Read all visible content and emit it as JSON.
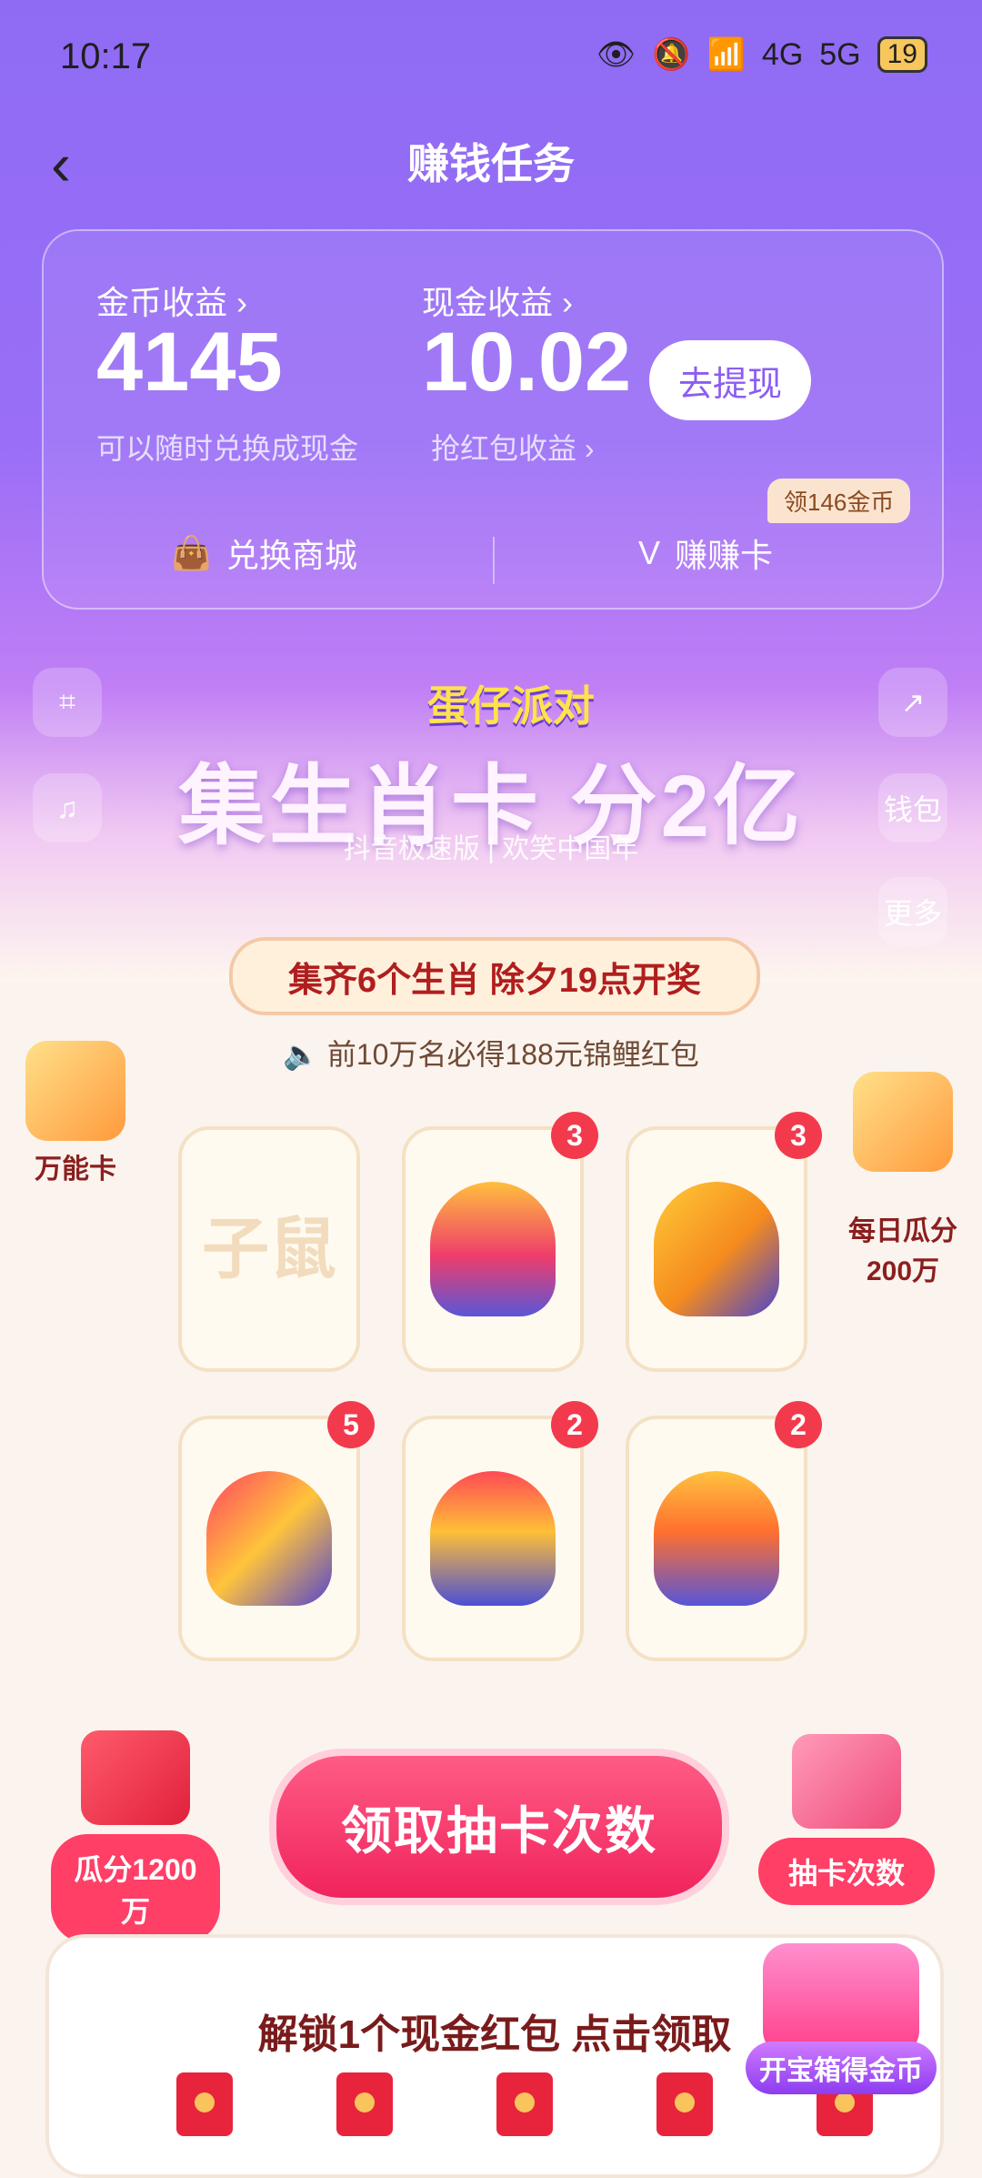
{
  "status_bar": {
    "time": "10:17",
    "signal_1": "4G",
    "signal_2": "5G",
    "battery": "19"
  },
  "header": {
    "back_icon": "‹",
    "title": "赚钱任务"
  },
  "earnings": {
    "coin_label": "金币收益 ›",
    "coin_value": "4145",
    "coin_note": "可以随时兑换成现金",
    "cash_label": "现金收益 ›",
    "cash_value": "10.02",
    "cash_note": "抢红包收益 ›",
    "withdraw_button": "去提现",
    "shop_label": "兑换商城",
    "earn_card_label": "赚赚卡",
    "earn_card_badge": "领146金币"
  },
  "side_actions": {
    "wallet": "钱包",
    "more": "更多"
  },
  "banner": {
    "logo": "蛋仔派对",
    "title": "集生肖卡 分2亿",
    "sub": "抖音极速版 | 欢笑中国年"
  },
  "event": {
    "ribbon": "集齐6个生肖 除夕19点开奖",
    "notice": "前10万名必得188元锦鲤红包"
  },
  "left_prize": {
    "label": "万能卡"
  },
  "right_prize": {
    "label": "每日瓜分\n200万"
  },
  "cards": [
    {
      "name": "子鼠",
      "count": ""
    },
    {
      "name": "",
      "count": "3"
    },
    {
      "name": "",
      "count": "3"
    },
    {
      "name": "",
      "count": "5"
    },
    {
      "name": "",
      "count": "2"
    },
    {
      "name": "",
      "count": "2"
    }
  ],
  "bottom_actions": {
    "left_label": "瓜分1200万",
    "main_button": "领取抽卡次数",
    "right_label": "抽卡次数"
  },
  "bottom_card": {
    "title": "解锁1个现金红包 点击领取",
    "chest_label": "开宝箱得金币"
  },
  "colors": {
    "purple": "#8f6bf4",
    "red": "#f0245d",
    "gold": "#f8c45b"
  }
}
